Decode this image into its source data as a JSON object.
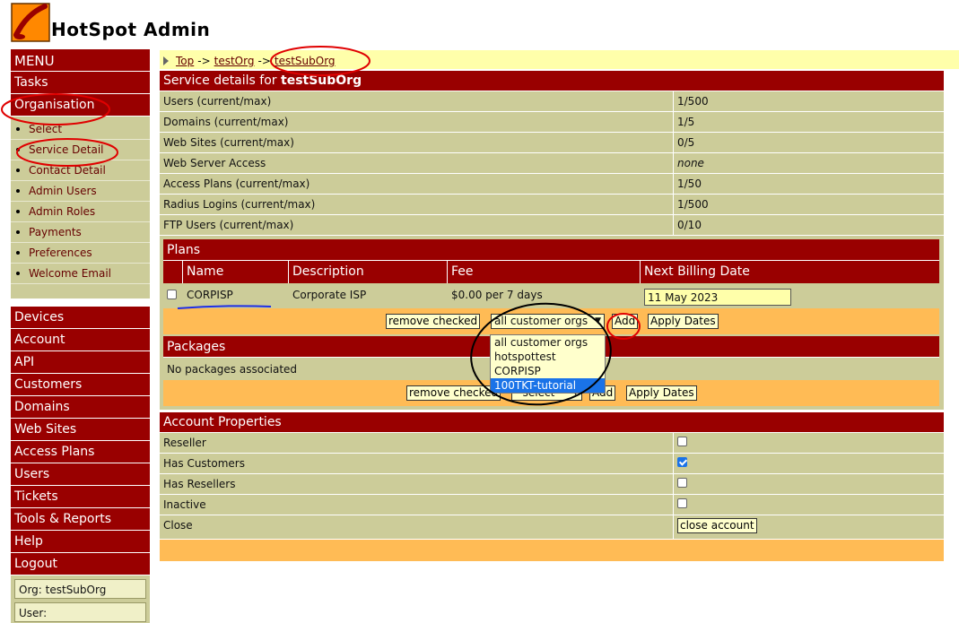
{
  "app": {
    "title": "HotSpot Admin"
  },
  "sidebar": {
    "menu_label": "MENU",
    "top_items": [
      "Tasks",
      "Organisation"
    ],
    "sub_items": [
      "Select",
      "Service Detail",
      "Contact Detail",
      "Admin Users",
      "Admin Roles",
      "Payments",
      "Preferences",
      "Welcome Email"
    ],
    "main_items": [
      "Devices",
      "Account",
      "API",
      "Customers",
      "Domains",
      "Web Sites",
      "Access Plans",
      "Users",
      "Tickets",
      "Tools & Reports",
      "Help",
      "Logout"
    ],
    "org_line": "Org: testSubOrg",
    "user_line": "User:"
  },
  "breadcrumb": {
    "items": [
      "Top",
      "testOrg",
      "testSubOrg"
    ],
    "separator": "->"
  },
  "service": {
    "heading_prefix": "Service details for",
    "heading_org": "testSubOrg",
    "rows": [
      {
        "label": "Users (current/max)",
        "value": "1/500"
      },
      {
        "label": "Domains (current/max)",
        "value": "1/5"
      },
      {
        "label": "Web Sites (current/max)",
        "value": "0/5"
      },
      {
        "label": "Web Server Access",
        "value": "none"
      },
      {
        "label": "Access Plans (current/max)",
        "value": "1/50"
      },
      {
        "label": "Radius Logins (current/max)",
        "value": "1/500"
      },
      {
        "label": "FTP Users (current/max)",
        "value": "0/10"
      }
    ]
  },
  "plans": {
    "heading": "Plans",
    "columns": [
      "Name",
      "Description",
      "Fee",
      "Next Billing Date"
    ],
    "row": {
      "name": "CORPISP",
      "description": "Corporate ISP",
      "fee": "$0.00 per 7 days",
      "billing_date": "11 May 2023"
    },
    "remove_label": "remove checked",
    "select_value": "all customer orgs",
    "add_label": "Add",
    "apply_label": "Apply Dates",
    "dropdown_options": [
      "all customer orgs",
      "hotspottest",
      "CORPISP",
      "100TKT-tutorial"
    ]
  },
  "packages": {
    "heading": "Packages",
    "empty_text": "No packages associated",
    "remove_label": "remove checked",
    "select_value": "--select--",
    "add_label": "Add",
    "apply_label": "Apply Dates"
  },
  "account": {
    "heading": "Account Properties",
    "rows": [
      {
        "label": "Reseller",
        "checked": false
      },
      {
        "label": "Has Customers",
        "checked": true
      },
      {
        "label": "Has Resellers",
        "checked": false
      },
      {
        "label": "Inactive",
        "checked": false
      }
    ],
    "close_label": "Close",
    "close_button": "close account"
  },
  "colors": {
    "header_red": "#990000",
    "row_khaki": "#cccc99",
    "bar_orange": "#ffbb55",
    "crumb_yellow": "#ffffaa",
    "annotation_red": "#e00000",
    "annotation_blue": "#1e2ee6"
  }
}
